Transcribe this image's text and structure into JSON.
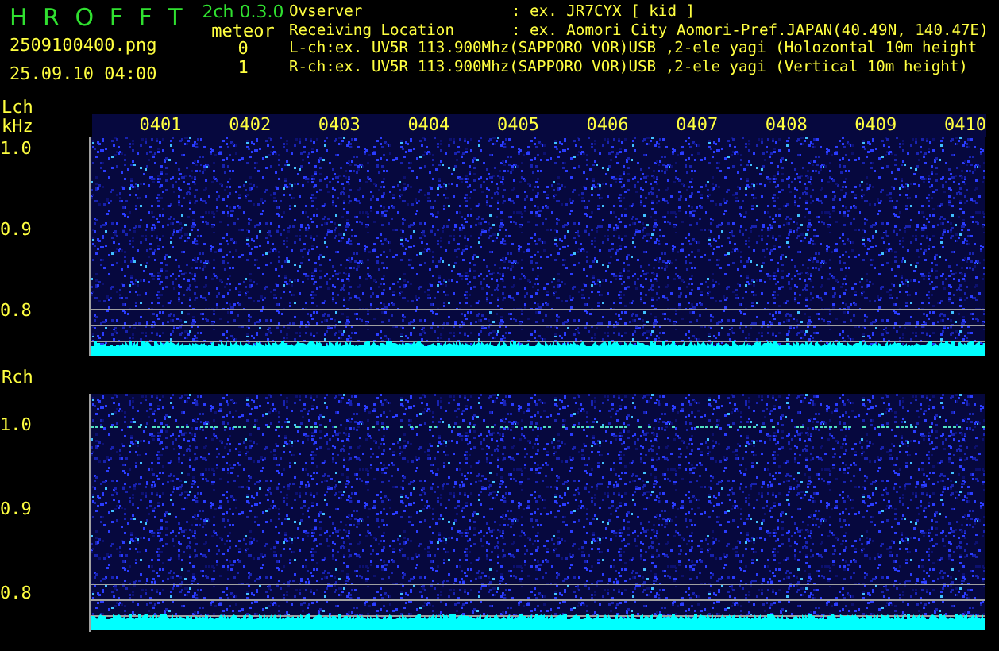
{
  "header": {
    "title": "H R O F F T",
    "filename": "2509100400.png",
    "datetime": "25.09.10 04:00",
    "version": "2ch 0.3.0",
    "meteor_label": "meteor",
    "meteor_counts": [
      "0",
      "1"
    ],
    "info": [
      {
        "label": "Ovserver",
        "value": ": ex. JR7CYX [ kid ]"
      },
      {
        "label": "Receiving Location",
        "value": ": ex. Aomori City Aomori-Pref.JAPAN(40.49N, 140.47E)"
      }
    ],
    "channel_lines": [
      "L-ch:ex. UV5R 113.900Mhz(SAPPORO VOR)USB ,2-ele yagi (Holozontal 10m height",
      "R-ch:ex. UV5R 113.900Mhz(SAPPORO VOR)USB ,2-ele yagi (Vertical 10m height)"
    ]
  },
  "panels": [
    {
      "channel": "Lch",
      "unit": "kHz",
      "time_labels": [
        "0401",
        "0402",
        "0403",
        "0404",
        "0405",
        "0406",
        "0407",
        "0408",
        "0409",
        "0410"
      ],
      "y_labels": [
        "1.0",
        "0.9",
        "0.8"
      ],
      "meteor_trace": false
    },
    {
      "channel": "Rch",
      "y_labels": [
        "1.0",
        "0.9",
        "0.8"
      ],
      "meteor_trace": true
    }
  ]
}
